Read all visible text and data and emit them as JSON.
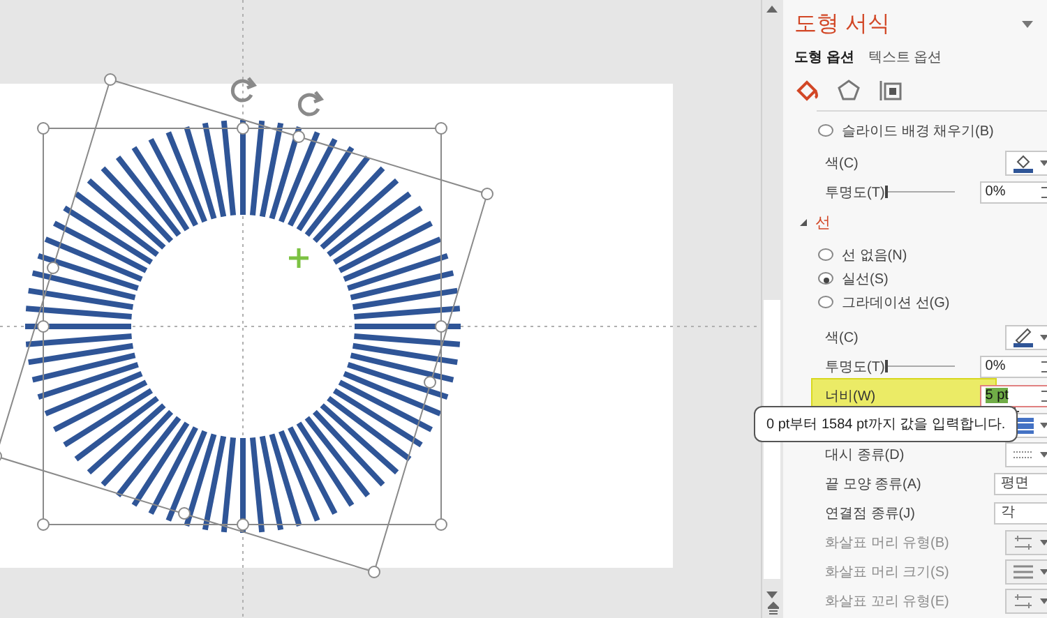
{
  "title": "도형 서식",
  "tabs": [
    {
      "label": "도형 옵션",
      "selected": true
    },
    {
      "label": "텍스트 옵션",
      "selected": false
    }
  ],
  "category_icons": [
    {
      "kind": "fill",
      "selected": true
    },
    {
      "kind": "effects",
      "selected": false
    },
    {
      "kind": "size",
      "selected": false
    }
  ],
  "fill_rows": [
    {
      "kind": "radio",
      "label": "슬라이드 배경 채우기(B)",
      "checked": false,
      "disabled": false
    },
    {
      "kind": "fill-color",
      "label": "색(C)",
      "disabled": false
    },
    {
      "kind": "slider",
      "label": "투명도(T)",
      "level": 0,
      "value": "0%",
      "disabled": false
    }
  ],
  "line_section": {
    "label": "선",
    "expanded": true,
    "rows": [
      {
        "kind": "radio",
        "label": "선 없음(N)",
        "checked": false,
        "disabled": false
      },
      {
        "kind": "radio",
        "label": "실선(S)",
        "checked": true,
        "disabled": false
      },
      {
        "kind": "radio",
        "label": "그라데이션 선(G)",
        "checked": false,
        "disabled": false
      },
      {
        "kind": "line-color",
        "label": "색(C)",
        "disabled": false
      },
      {
        "kind": "slider",
        "label": "투명도(T)",
        "level": 0,
        "value": "0%",
        "disabled": false
      },
      {
        "kind": "spin",
        "label": "너비(W)",
        "value": "5 pt",
        "text_selected": true,
        "disabled": false
      },
      {
        "kind": "compound",
        "disabled": false
      },
      {
        "kind": "dash",
        "label": "대시 종류(D)",
        "disabled": false
      },
      {
        "kind": "dropdown",
        "label": "끝 모양 종류(A)",
        "value": "평면",
        "disabled": false
      },
      {
        "kind": "dropdown",
        "label": "연결점 종류(J)",
        "value": "각",
        "disabled": false
      },
      {
        "kind": "arrow-type",
        "label": "화살표 머리 유형(B)",
        "disabled": true
      },
      {
        "kind": "arrow-size",
        "label": "화살표 머리 크기(S)",
        "disabled": true
      },
      {
        "kind": "arrow-type",
        "label": "화살표 꼬리 유형(E)",
        "disabled": true
      }
    ]
  },
  "tooltip": "0 pt부터 1584 pt까지 값을 입력합니다."
}
